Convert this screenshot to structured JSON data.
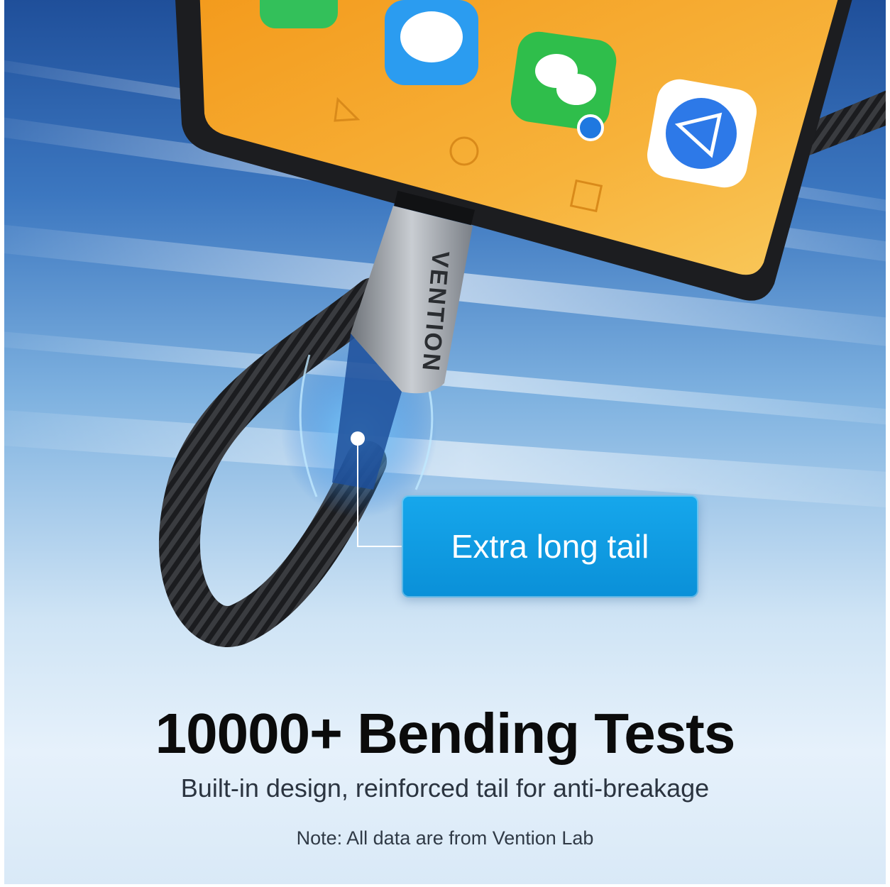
{
  "brand": "VENTION",
  "callout": {
    "label": "Extra long tail"
  },
  "headline": "10000+ Bending Tests",
  "subline": "Built-in design, reinforced tail for anti-breakage",
  "note": "Note: All data are from Vention Lab",
  "colors": {
    "callout": "#0a90d8",
    "screen": "#f5a623",
    "background_top": "#1f4f9a"
  },
  "phone_icons": [
    "phone-icon",
    "message-icon",
    "wechat-icon",
    "browser-icon"
  ]
}
